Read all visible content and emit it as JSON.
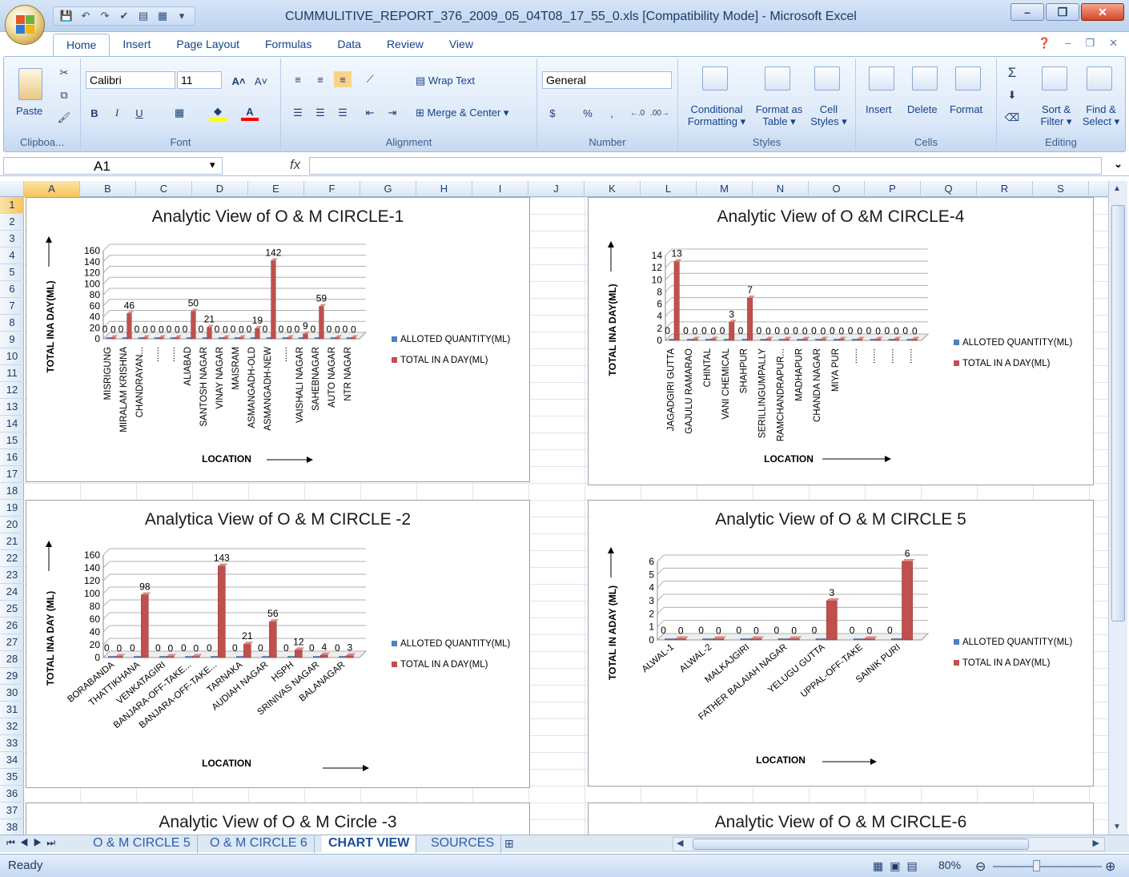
{
  "window": {
    "title": "CUMMULITIVE_REPORT_376_2009_05_04T08_17_55_0.xls  [Compatibility Mode] - Microsoft Excel"
  },
  "ribbon_tabs": [
    "Home",
    "Insert",
    "Page Layout",
    "Formulas",
    "Data",
    "Review",
    "View"
  ],
  "ribbon": {
    "clipboard": {
      "paste": "Paste",
      "label": "Clipboa..."
    },
    "font": {
      "name": "Calibri",
      "size": "11",
      "label": "Font",
      "bold": "B",
      "italic": "I",
      "underline": "U"
    },
    "alignment": {
      "wrap": "Wrap Text",
      "merge": "Merge & Center",
      "label": "Alignment"
    },
    "number": {
      "format": "General",
      "label": "Number",
      "percent": "%",
      "comma": ","
    },
    "styles": {
      "conditional": "Conditional",
      "conditional2": "Formatting",
      "format_as": "Format as",
      "format_as2": "Table",
      "cell": "Cell",
      "cell2": "Styles",
      "label": "Styles"
    },
    "cells": {
      "insert": "Insert",
      "delete": "Delete",
      "format": "Format",
      "label": "Cells"
    },
    "editing": {
      "sort": "Sort &",
      "sort2": "Filter",
      "find": "Find &",
      "find2": "Select",
      "label": "Editing",
      "sigma": "Σ"
    }
  },
  "formula_bar": {
    "name_box": "A1",
    "fx": "fx"
  },
  "columns": [
    "A",
    "B",
    "C",
    "D",
    "E",
    "F",
    "G",
    "H",
    "I",
    "J",
    "K",
    "L",
    "M",
    "N",
    "O",
    "P",
    "Q",
    "R",
    "S"
  ],
  "rows": [
    "1",
    "2",
    "3",
    "4",
    "5",
    "6",
    "7",
    "8",
    "9",
    "10",
    "11",
    "12",
    "13",
    "14",
    "15",
    "16",
    "17",
    "18",
    "19",
    "20",
    "21",
    "22",
    "23",
    "24",
    "25",
    "26",
    "27",
    "28",
    "29",
    "30",
    "31",
    "32",
    "33",
    "34",
    "35",
    "36",
    "37",
    "38"
  ],
  "sheets": [
    "O & M CIRCLE 5",
    "O & M CIRCLE 6",
    "CHART VIEW",
    "SOURCES"
  ],
  "status": {
    "ready": "Ready",
    "zoom": "80%"
  },
  "colors": {
    "allotted": "#4f81bd",
    "total": "#c0504d"
  },
  "chart_data": [
    {
      "id": "c1",
      "type": "bar",
      "title": "Analytic View of O & M CIRCLE-1",
      "ylabel": "TOTAL INA DAY(ML)",
      "xlabel": "LOCATION",
      "ylim": [
        0,
        160
      ],
      "yticks": [
        0,
        20,
        40,
        60,
        80,
        100,
        120,
        140,
        160
      ],
      "categories": [
        "MISRIGUNG",
        "MIRALAM KRISHNA",
        "CHANDRAYAN...",
        "......",
        "......",
        "ALIABAD",
        "SANTOSH NAGAR",
        "VINAY NAGAR",
        "MAISRAM",
        "ASMANGADH-OLD",
        "ASMANGADH-NEW",
        "......",
        "VAISHALI NAGAR",
        "SAHEBNAGAR",
        "AUTO NAGAR",
        "NTR NAGAR"
      ],
      "series": [
        {
          "name": "ALLOTED QUANTITY(ML)",
          "values": [
            0,
            0,
            0,
            0,
            0,
            0,
            0,
            0,
            0,
            0,
            0,
            0,
            0,
            0,
            0,
            0
          ]
        },
        {
          "name": "TOTAL IN A DAY(ML)",
          "values": [
            0,
            46,
            0,
            0,
            0,
            50,
            21,
            0,
            0,
            19,
            142,
            0,
            9,
            59,
            0,
            0
          ]
        }
      ]
    },
    {
      "id": "c4",
      "type": "bar",
      "title": "Analytic View of O &M  CIRCLE-4",
      "ylabel": "TOTAL INA DAY(ML)",
      "xlabel": "LOCATION",
      "ylim": [
        0,
        14
      ],
      "yticks": [
        0,
        2,
        4,
        6,
        8,
        10,
        12,
        14
      ],
      "categories": [
        "JAGADGIRI GUTTA",
        "GAJULU RAMARAO",
        "CHINTAL",
        "VANI CHEMICAL",
        "SHAHPUR",
        "SERILLINGUMPALLY",
        "RAMCHANDRAPUR...",
        "MADHAPUR",
        "CHANDA NAGAR",
        "MIYA PUR",
        "......",
        "......",
        "......",
        "......"
      ],
      "series": [
        {
          "name": "ALLOTED QUANTITY(ML)",
          "values": [
            0,
            0,
            0,
            0,
            0,
            0,
            0,
            0,
            0,
            0,
            0,
            0,
            0,
            0
          ]
        },
        {
          "name": "TOTAL IN A DAY(ML)",
          "values": [
            13,
            0,
            0,
            3,
            7,
            0,
            0,
            0,
            0,
            0,
            0,
            0,
            0,
            0
          ]
        }
      ]
    },
    {
      "id": "c2",
      "type": "bar",
      "title": "Analytica View of  O & M CIRCLE -2",
      "ylabel": "TOTAL INA DAY (ML)",
      "xlabel": "LOCATION",
      "ylim": [
        0,
        160
      ],
      "yticks": [
        0,
        20,
        40,
        60,
        80,
        100,
        120,
        140,
        160
      ],
      "categories": [
        "BORABANDA",
        "THATTIKHANA",
        "VENKATAGIRI",
        "BANJARA-OFF-TAKE...",
        "BANJARA-OFF-TAKE...",
        "TARNAKA",
        "AUDIAH NAGAR",
        "HSPH",
        "SRINIVAS NAGAR",
        "BALANAGAR"
      ],
      "series": [
        {
          "name": "ALLOTED QUANTITY(ML)",
          "values": [
            0,
            0,
            0,
            0,
            0,
            0,
            0,
            0,
            0,
            0
          ]
        },
        {
          "name": "TOTAL IN A DAY(ML)",
          "values": [
            0,
            98,
            0,
            0,
            143,
            21,
            56,
            12,
            4,
            3
          ]
        }
      ]
    },
    {
      "id": "c5",
      "type": "bar",
      "title": "Analytic View of O & M CIRCLE 5",
      "ylabel": "TOTAL IN ADAY (ML)",
      "xlabel": "LOCATION",
      "ylim": [
        0,
        6
      ],
      "yticks": [
        0,
        1,
        2,
        3,
        4,
        5,
        6
      ],
      "categories": [
        "ALWAL-1",
        "ALWAL-2",
        "MALKAJGIRI",
        "FATHER BALAIAH NAGAR",
        "YELUGU GUTTA",
        "UPPAL-OFF-TAKE",
        "SAINIK PURI"
      ],
      "series": [
        {
          "name": "ALLOTED QUANTITY(ML)",
          "values": [
            0,
            0,
            0,
            0,
            0,
            0,
            0
          ]
        },
        {
          "name": "TOTAL IN A DAY(ML)",
          "values": [
            0,
            0,
            0,
            0,
            3,
            0,
            6
          ]
        }
      ]
    },
    {
      "id": "c3",
      "type": "bar",
      "title": "Analytic View of O & M Circle -3"
    },
    {
      "id": "c6",
      "type": "bar",
      "title": "Analytic View of O & M CIRCLE-6"
    }
  ]
}
